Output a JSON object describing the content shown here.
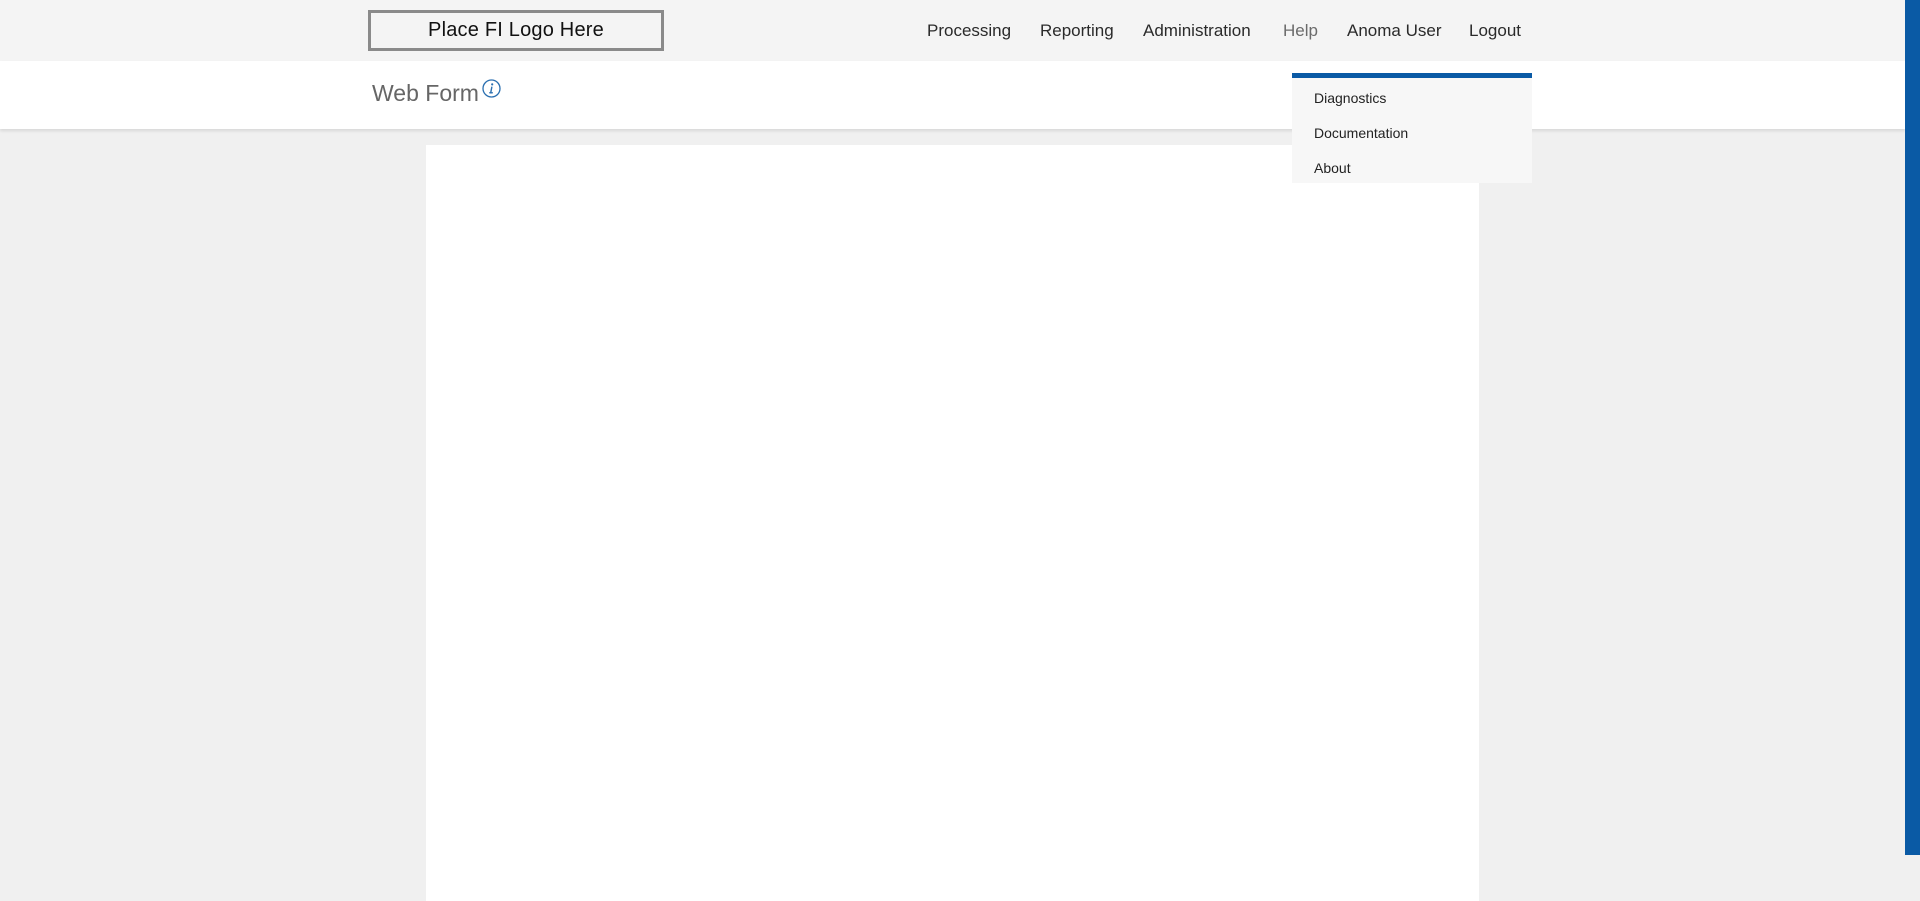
{
  "header": {
    "logo_text": "Place FI Logo Here",
    "nav": {
      "processing": "Processing",
      "reporting": "Reporting",
      "administration": "Administration",
      "help": "Help",
      "user": "Anoma User",
      "logout": "Logout"
    }
  },
  "page": {
    "title": "Web Form",
    "info_icon": "info-icon"
  },
  "help_menu": {
    "items": [
      {
        "label": "Diagnostics"
      },
      {
        "label": "Documentation"
      },
      {
        "label": "About"
      }
    ]
  },
  "colors": {
    "accent": "#0a5aa5",
    "header_bg": "#f4f4f4",
    "page_bg": "#f0f0f0",
    "panel_bg": "#ffffff"
  }
}
